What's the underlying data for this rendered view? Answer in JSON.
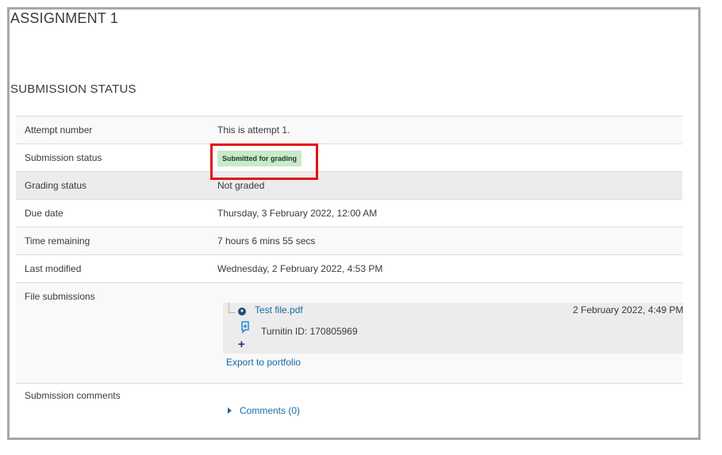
{
  "assignment": {
    "title": "ASSIGNMENT 1"
  },
  "section": {
    "title": "SUBMISSION STATUS"
  },
  "rows": {
    "attempt": {
      "label": "Attempt number",
      "value": "This is attempt 1."
    },
    "submission": {
      "label": "Submission status",
      "value": "Submitted for grading"
    },
    "grading": {
      "label": "Grading status",
      "value": "Not graded"
    },
    "due": {
      "label": "Due date",
      "value": "Thursday, 3 February 2022, 12:00 AM"
    },
    "remaining": {
      "label": "Time remaining",
      "value": "7 hours 6 mins 55 secs"
    },
    "modified": {
      "label": "Last modified",
      "value": "Wednesday, 2 February 2022, 4:53 PM"
    },
    "files": {
      "label": "File submissions",
      "file_name": "Test file.pdf",
      "file_date": "2 February 2022, 4:49 PM",
      "turnitin": "Turnitin ID: 170805969",
      "export_link": "Export to portfolio"
    },
    "comments": {
      "label": "Submission comments",
      "toggle": "Comments (0)"
    }
  },
  "colors": {
    "badge_bg": "#c9e9cc",
    "highlight": "#e41111",
    "link": "#1a6aa3"
  }
}
